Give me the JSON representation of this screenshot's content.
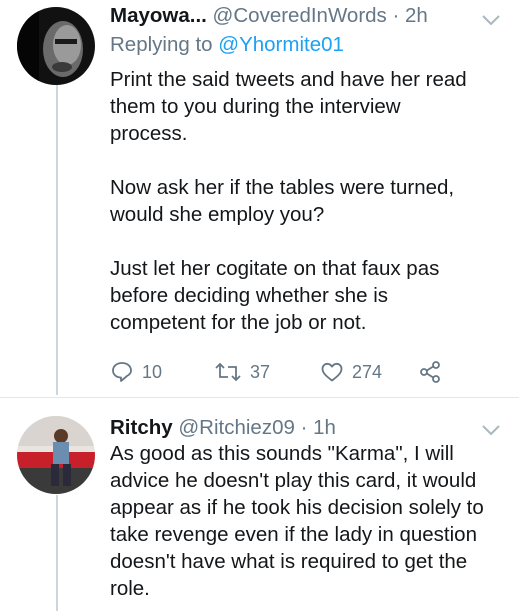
{
  "tweets": [
    {
      "display_name": "Mayowa...",
      "handle": "@CoveredInWords",
      "separator": "·",
      "time": "2h",
      "replying_label": "Replying to",
      "replying_handle": "@Yhormite01",
      "paragraphs": [
        "Print the said tweets and have her read\nthem to you during the interview\nprocess.",
        "Now ask her if the tables were turned,\nwould she employ you?",
        "Just let her cogitate on that faux pas\nbefore deciding whether she is\ncompetent for the job or not."
      ],
      "actions": {
        "reply_count": "10",
        "retweet_count": "37",
        "like_count": "274"
      }
    },
    {
      "display_name": "Ritchy",
      "handle": "@Ritchiez09",
      "separator": "·",
      "time": "1h",
      "paragraphs": [
        "As good as this sounds  \"Karma\", I will\nadvice he doesn't play this card, it would\nappear as if he took his decision solely to\ntake revenge even if the lady in  question\ndoesn't have what is required to get the\nrole."
      ]
    }
  ],
  "colors": {
    "text": "#14171a",
    "muted": "#657786",
    "link": "#1da1f2",
    "thread_line": "#ccd6dd"
  },
  "icons": [
    "chevron-down-icon",
    "reply-icon",
    "retweet-icon",
    "like-icon",
    "share-icon"
  ]
}
